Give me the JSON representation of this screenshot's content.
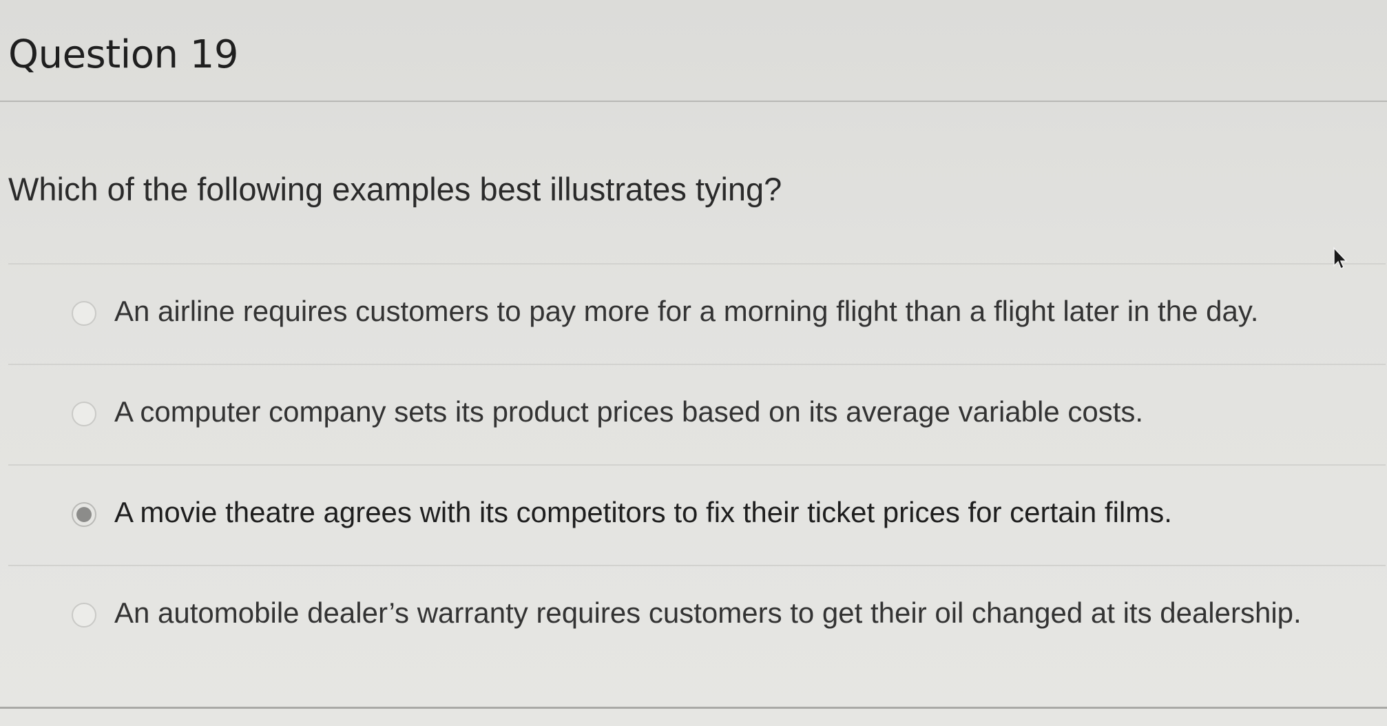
{
  "question": {
    "title": "Question 19",
    "prompt": "Which of the following examples best illustrates tying?"
  },
  "answers": [
    {
      "label": "An airline requires customers to pay more for a morning flight than a flight later in the day.",
      "selected": false
    },
    {
      "label": "A computer company sets its product prices based on its average variable costs.",
      "selected": false
    },
    {
      "label": "A movie theatre agrees with its competitors to fix their ticket prices for certain films.",
      "selected": true
    },
    {
      "label": "An automobile dealer’s warranty requires customers to get their oil changed at its dealership.",
      "selected": false
    }
  ],
  "icons": {
    "radio_unselected": "radio-empty-icon",
    "radio_selected": "radio-filled-icon",
    "cursor": "mouse-pointer-icon"
  },
  "colors": {
    "background": "#e2e2df",
    "text": "#2b2b2b",
    "radio_fill": "#8c8c8a"
  }
}
